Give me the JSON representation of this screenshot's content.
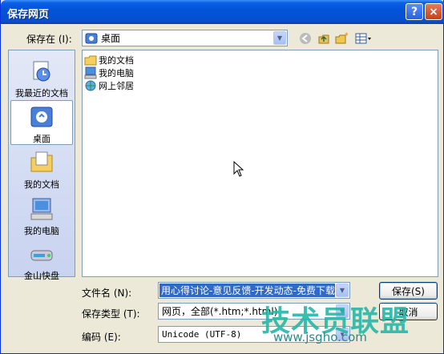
{
  "window": {
    "title": "保存网页",
    "help_glyph": "?",
    "close_glyph": "×"
  },
  "save_in": {
    "label": "保存在 (I):",
    "value": "桌面"
  },
  "places": [
    {
      "label": "我最近的文档",
      "icon": "recent-docs-icon"
    },
    {
      "label": "桌面",
      "icon": "desktop-icon",
      "selected": true
    },
    {
      "label": "我的文档",
      "icon": "my-documents-icon"
    },
    {
      "label": "我的电脑",
      "icon": "my-computer-icon"
    },
    {
      "label": "金山快盘",
      "icon": "kuaipan-drive-icon"
    }
  ],
  "files": [
    {
      "label": "我的文档",
      "icon": "folder-icon"
    },
    {
      "label": "我的电脑",
      "icon": "computer-icon"
    },
    {
      "label": "网上邻居",
      "icon": "network-icon"
    }
  ],
  "filename": {
    "label": "文件名 (N):",
    "value": "用心得讨论-意见反馈-开发动态-免费下载"
  },
  "filetype": {
    "label": "保存类型 (T):",
    "value": "网页，全部(*.htm;*.html)"
  },
  "encoding": {
    "label": "编码 (E):",
    "value": "Unicode (UTF-8)"
  },
  "buttons": {
    "save": "保存(S)",
    "cancel": "取消"
  },
  "watermark": {
    "text": "技术员联盟",
    "url": "www.jsgho.com"
  },
  "colors": {
    "titlebar": "#0453d8",
    "selection": "#316ac5",
    "watermark": "#29b6a8"
  }
}
